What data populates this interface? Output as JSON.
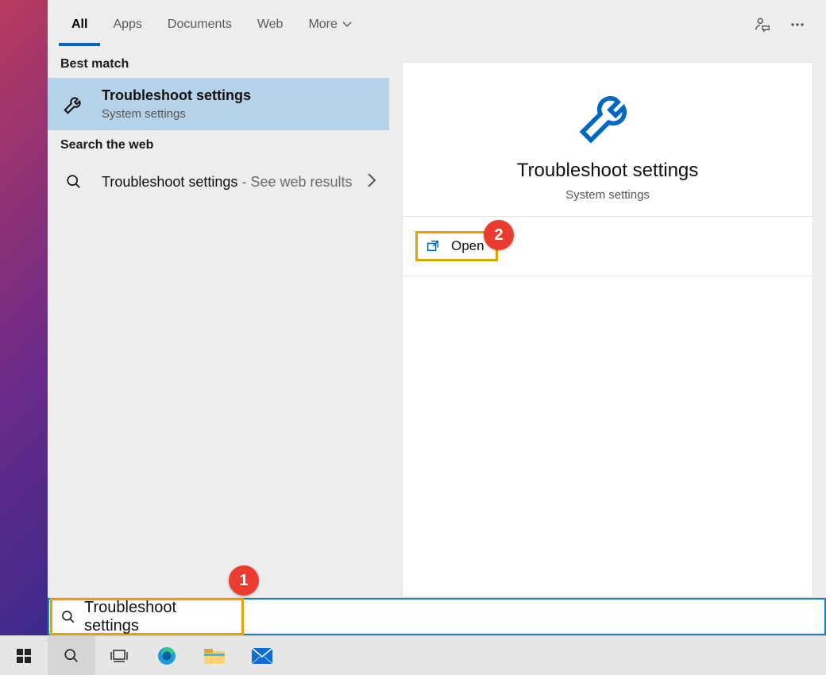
{
  "tabs": {
    "all": "All",
    "apps": "Apps",
    "documents": "Documents",
    "web": "Web",
    "more": "More"
  },
  "sections": {
    "best_match": "Best match",
    "search_web": "Search the web"
  },
  "best_match": {
    "title": "Troubleshoot settings",
    "subtitle": "System settings"
  },
  "web_result": {
    "title": "Troubleshoot settings",
    "suffix": " - See web results"
  },
  "detail": {
    "title": "Troubleshoot settings",
    "subtitle": "System settings",
    "open_label": "Open"
  },
  "search": {
    "value": "Troubleshoot settings"
  },
  "annotations": {
    "step1": "1",
    "step2": "2"
  },
  "colors": {
    "accent": "#0067c0",
    "highlight_border": "#e6a300",
    "selection_bg": "#b6d2e8",
    "badge_bg": "#ec3b2f"
  }
}
